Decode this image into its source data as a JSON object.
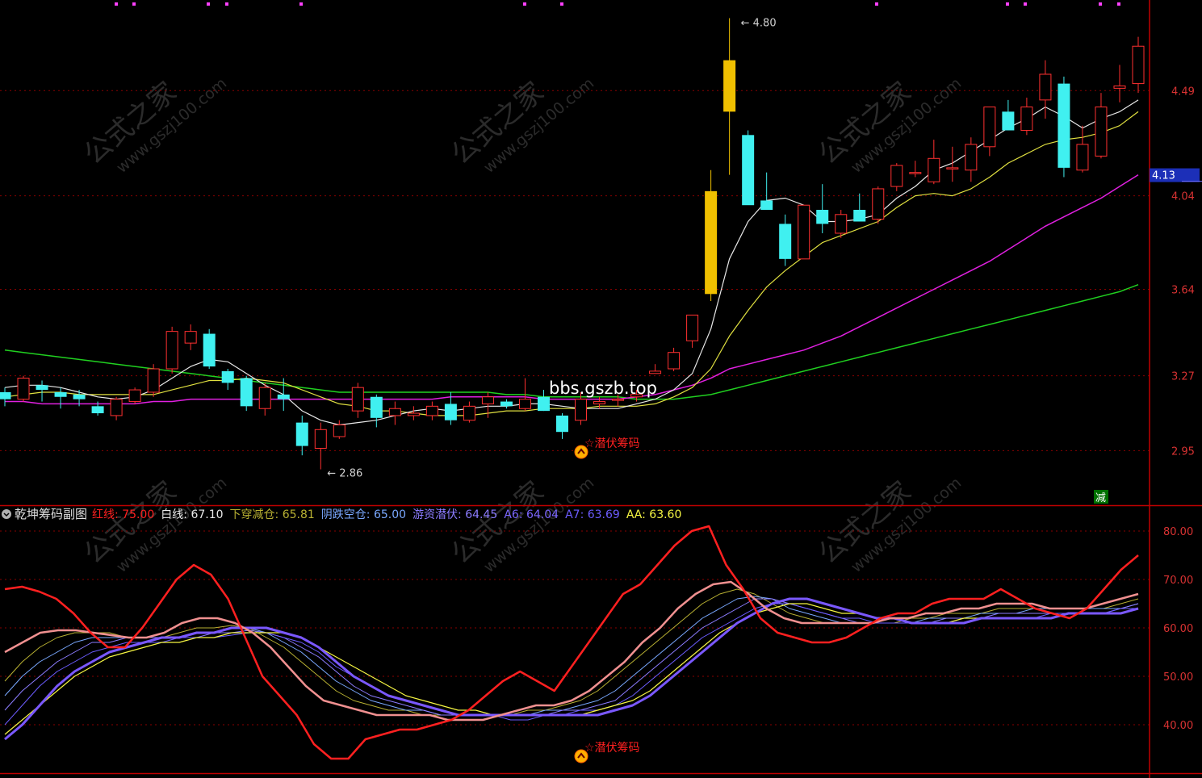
{
  "watermark": {
    "cn": "公式之家",
    "url": "www.gszj100.com"
  },
  "site_label": "bbs.gszb.top",
  "main_panel": {
    "price_axis": {
      "ticks": [
        4.49,
        4.04,
        3.64,
        3.27,
        2.95
      ],
      "min": 2.72,
      "max": 4.85
    },
    "current_price_tag": {
      "value": "4.13",
      "color": "#1c2fb8"
    },
    "high_marker": {
      "value": 4.8,
      "text": "4.80"
    },
    "low_marker": {
      "value": 2.86,
      "text": "2.86"
    },
    "signal_label": "潜伏筹码",
    "corner_badge": "减"
  },
  "sub_panel": {
    "title": "乾坤筹码副图",
    "legend": [
      {
        "key": "红线",
        "label": "红线: ",
        "value": "75.00",
        "color": "#ff2020"
      },
      {
        "key": "白线",
        "label": "白线: ",
        "value": "67.10",
        "color": "#e8e8e8"
      },
      {
        "key": "下穿减仓",
        "label": "下穿减仓: ",
        "value": "65.81",
        "color": "#b8b032"
      },
      {
        "key": "阴跌空仓",
        "label": "阴跌空仓: ",
        "value": "65.00",
        "color": "#7aa8ff"
      },
      {
        "key": "游资潜伏",
        "label": "游资潜伏: ",
        "value": "64.45",
        "color": "#8c7cff"
      },
      {
        "key": "A6",
        "label": "A6: ",
        "value": "64.04",
        "color": "#7b66ff"
      },
      {
        "key": "A7",
        "label": "A7: ",
        "value": "63.69",
        "color": "#6c5cff"
      },
      {
        "key": "AA",
        "label": "AA: ",
        "value": "63.60",
        "color": "#f5f542"
      }
    ],
    "value_axis": {
      "ticks": [
        "80.00",
        "70.00",
        "60.00",
        "50.00",
        "40.00"
      ],
      "min": 30,
      "max": 85
    },
    "signal_label": "潜伏筹码"
  },
  "chart_data": [
    {
      "type": "candlestick",
      "title": "",
      "ylim": [
        2.72,
        4.85
      ],
      "candles": [
        [
          3.2,
          3.22,
          3.14,
          3.17
        ],
        [
          3.17,
          3.27,
          3.16,
          3.26
        ],
        [
          3.23,
          3.25,
          3.16,
          3.21
        ],
        [
          3.2,
          3.22,
          3.13,
          3.18
        ],
        [
          3.19,
          3.21,
          3.14,
          3.17
        ],
        [
          3.14,
          3.16,
          3.1,
          3.11
        ],
        [
          3.1,
          3.18,
          3.08,
          3.17
        ],
        [
          3.16,
          3.22,
          3.15,
          3.21
        ],
        [
          3.2,
          3.32,
          3.18,
          3.3
        ],
        [
          3.3,
          3.48,
          3.28,
          3.46
        ],
        [
          3.41,
          3.49,
          3.38,
          3.46
        ],
        [
          3.45,
          3.47,
          3.3,
          3.31
        ],
        [
          3.29,
          3.3,
          3.21,
          3.24
        ],
        [
          3.26,
          3.27,
          3.12,
          3.14
        ],
        [
          3.13,
          3.24,
          3.1,
          3.22
        ],
        [
          3.19,
          3.26,
          3.12,
          3.17
        ],
        [
          3.07,
          3.1,
          2.93,
          2.97
        ],
        [
          2.96,
          3.07,
          2.87,
          3.04
        ],
        [
          3.01,
          3.08,
          3.0,
          3.06
        ],
        [
          3.12,
          3.24,
          3.09,
          3.22
        ],
        [
          3.18,
          3.19,
          3.05,
          3.09
        ],
        [
          3.1,
          3.16,
          3.06,
          3.13
        ],
        [
          3.1,
          3.14,
          3.08,
          3.11
        ],
        [
          3.1,
          3.16,
          3.08,
          3.14
        ],
        [
          3.15,
          3.2,
          3.06,
          3.08
        ],
        [
          3.08,
          3.16,
          3.07,
          3.14
        ],
        [
          3.15,
          3.2,
          3.09,
          3.18
        ],
        [
          3.16,
          3.17,
          3.13,
          3.14
        ],
        [
          3.13,
          3.26,
          3.12,
          3.17
        ],
        [
          3.18,
          3.21,
          3.12,
          3.12
        ],
        [
          3.1,
          3.11,
          3.0,
          3.03
        ],
        [
          3.08,
          3.2,
          3.06,
          3.17
        ],
        [
          3.15,
          3.18,
          3.13,
          3.16
        ],
        [
          3.17,
          3.19,
          3.14,
          3.17
        ],
        [
          3.18,
          3.21,
          3.16,
          3.19
        ],
        [
          3.28,
          3.32,
          3.28,
          3.29
        ],
        [
          3.3,
          3.39,
          3.29,
          3.37
        ],
        [
          3.42,
          3.52,
          3.39,
          3.53
        ],
        [
          3.62,
          4.15,
          3.59,
          4.06
        ],
        [
          4.4,
          4.8,
          4.13,
          4.62
        ],
        [
          4.3,
          4.32,
          4.12,
          4.0
        ],
        [
          4.02,
          4.14,
          3.98,
          3.98
        ],
        [
          3.92,
          3.96,
          3.74,
          3.77
        ],
        [
          3.77,
          4.0,
          3.79,
          4.0
        ],
        [
          3.98,
          4.09,
          3.88,
          3.92
        ],
        [
          3.88,
          3.98,
          3.86,
          3.96
        ],
        [
          3.98,
          4.05,
          3.94,
          3.93
        ],
        [
          3.94,
          4.08,
          3.92,
          4.07
        ],
        [
          4.08,
          4.18,
          4.06,
          4.17
        ],
        [
          4.14,
          4.19,
          4.12,
          4.14
        ],
        [
          4.1,
          4.28,
          4.09,
          4.2
        ],
        [
          4.16,
          4.25,
          4.1,
          4.16
        ],
        [
          4.15,
          4.29,
          4.1,
          4.26
        ],
        [
          4.25,
          4.4,
          4.21,
          4.42
        ],
        [
          4.4,
          4.45,
          4.32,
          4.32
        ],
        [
          4.32,
          4.46,
          4.3,
          4.42
        ],
        [
          4.45,
          4.62,
          4.37,
          4.56
        ],
        [
          4.52,
          4.55,
          4.12,
          4.16
        ],
        [
          4.15,
          4.34,
          4.14,
          4.26
        ],
        [
          4.21,
          4.48,
          4.2,
          4.42
        ],
        [
          4.5,
          4.6,
          4.44,
          4.51
        ],
        [
          4.52,
          4.72,
          4.48,
          4.68
        ]
      ],
      "ma_white": [
        3.22,
        3.23,
        3.23,
        3.22,
        3.2,
        3.18,
        3.17,
        3.18,
        3.21,
        3.26,
        3.31,
        3.34,
        3.33,
        3.28,
        3.23,
        3.19,
        3.12,
        3.08,
        3.06,
        3.07,
        3.08,
        3.1,
        3.12,
        3.13,
        3.12,
        3.13,
        3.14,
        3.14,
        3.15,
        3.15,
        3.14,
        3.13,
        3.13,
        3.13,
        3.15,
        3.17,
        3.21,
        3.28,
        3.47,
        3.77,
        3.93,
        4.02,
        4.03,
        4.0,
        3.93,
        3.93,
        3.94,
        3.96,
        4.03,
        4.08,
        4.15,
        4.18,
        4.23,
        4.28,
        4.33,
        4.37,
        4.42,
        4.38,
        4.33,
        4.37,
        4.4,
        4.45
      ],
      "ma_yellow": [
        3.18,
        3.19,
        3.2,
        3.2,
        3.19,
        3.19,
        3.19,
        3.19,
        3.19,
        3.21,
        3.23,
        3.25,
        3.25,
        3.26,
        3.25,
        3.24,
        3.21,
        3.18,
        3.15,
        3.14,
        3.12,
        3.12,
        3.11,
        3.1,
        3.1,
        3.1,
        3.11,
        3.12,
        3.12,
        3.13,
        3.13,
        3.13,
        3.14,
        3.14,
        3.14,
        3.15,
        3.18,
        3.22,
        3.3,
        3.44,
        3.55,
        3.65,
        3.72,
        3.78,
        3.84,
        3.87,
        3.9,
        3.93,
        3.99,
        4.04,
        4.05,
        4.04,
        4.07,
        4.12,
        4.18,
        4.22,
        4.26,
        4.28,
        4.29,
        4.31,
        4.34,
        4.4
      ],
      "ma_magenta": [
        3.16,
        3.16,
        3.15,
        3.15,
        3.15,
        3.15,
        3.15,
        3.15,
        3.16,
        3.16,
        3.17,
        3.17,
        3.17,
        3.17,
        3.17,
        3.17,
        3.17,
        3.17,
        3.17,
        3.17,
        3.17,
        3.17,
        3.17,
        3.17,
        3.18,
        3.18,
        3.18,
        3.18,
        3.18,
        3.17,
        3.17,
        3.17,
        3.17,
        3.17,
        3.18,
        3.19,
        3.21,
        3.23,
        3.26,
        3.3,
        3.32,
        3.34,
        3.36,
        3.38,
        3.41,
        3.44,
        3.48,
        3.52,
        3.56,
        3.6,
        3.64,
        3.68,
        3.72,
        3.76,
        3.81,
        3.86,
        3.91,
        3.95,
        3.99,
        4.03,
        4.08,
        4.13
      ],
      "ma_green": [
        3.38,
        3.37,
        3.36,
        3.35,
        3.34,
        3.33,
        3.32,
        3.31,
        3.3,
        3.29,
        3.28,
        3.27,
        3.26,
        3.25,
        3.24,
        3.23,
        3.22,
        3.21,
        3.2,
        3.2,
        3.2,
        3.2,
        3.2,
        3.2,
        3.2,
        3.2,
        3.2,
        3.19,
        3.19,
        3.18,
        3.18,
        3.18,
        3.18,
        3.18,
        3.17,
        3.17,
        3.17,
        3.18,
        3.19,
        3.21,
        3.23,
        3.25,
        3.27,
        3.29,
        3.31,
        3.33,
        3.35,
        3.37,
        3.39,
        3.41,
        3.43,
        3.45,
        3.47,
        3.49,
        3.51,
        3.53,
        3.55,
        3.57,
        3.59,
        3.61,
        3.63,
        3.66
      ],
      "marker_levels": {
        "high": 4.8,
        "low": 2.86
      }
    },
    {
      "type": "line",
      "title": "乾坤筹码副图",
      "ylim": [
        30,
        85
      ],
      "red_line": [
        68,
        68.5,
        67.5,
        66,
        63,
        59,
        56,
        56,
        60,
        65,
        70,
        73,
        71,
        66,
        58,
        50,
        46,
        42,
        36,
        33,
        33,
        37,
        38,
        39,
        39,
        40,
        41,
        43,
        46,
        49,
        51,
        49,
        47,
        52,
        57,
        62,
        67,
        69,
        73,
        77,
        80,
        81,
        73,
        68,
        62,
        59,
        58,
        57,
        57,
        58,
        60,
        62,
        63,
        63,
        65,
        66,
        66,
        66,
        68,
        66,
        64,
        63,
        62,
        64,
        68,
        72,
        75
      ],
      "white_line": [
        55,
        57,
        59,
        59.5,
        59.5,
        59,
        58.5,
        58,
        58,
        59,
        61,
        62,
        62,
        61,
        59,
        56,
        52,
        48,
        45,
        44,
        43,
        42,
        42,
        42,
        42,
        41,
        41,
        41,
        42,
        43,
        44,
        44,
        45,
        47,
        50,
        53,
        57,
        60,
        64,
        67,
        69,
        69.5,
        67,
        64,
        62,
        61,
        61,
        61,
        61,
        61,
        62,
        62,
        63,
        63,
        64,
        64,
        65,
        65,
        65,
        64,
        64,
        64,
        65,
        66,
        67
      ],
      "mid_lines": [
        [
          49,
          53,
          56,
          58,
          59,
          59,
          59,
          58,
          58,
          58,
          59,
          60,
          60,
          60.5,
          60,
          58,
          56,
          53,
          50,
          47,
          45,
          44,
          43,
          43,
          42,
          42,
          42,
          42,
          42,
          42,
          43,
          43,
          44,
          45,
          47,
          50,
          53,
          56,
          59,
          62,
          65,
          67,
          68,
          67,
          65,
          63,
          62,
          61,
          61,
          61,
          61,
          61,
          62,
          62,
          63,
          63,
          63,
          64,
          64,
          64,
          64,
          64,
          64,
          64,
          65,
          66
        ],
        [
          46,
          50,
          53,
          55,
          57,
          58,
          58,
          58,
          58,
          58,
          58,
          59,
          59,
          60,
          60,
          59,
          57,
          55,
          52,
          49,
          47,
          45,
          44,
          43,
          43,
          42,
          42,
          42,
          42,
          42,
          42,
          43,
          43,
          44,
          45,
          47,
          50,
          53,
          56,
          59,
          62,
          64,
          66,
          66.5,
          66,
          64,
          63,
          62,
          61,
          61,
          61,
          61,
          61,
          62,
          62,
          62,
          63,
          63,
          63,
          64,
          64,
          64,
          64,
          64,
          64,
          65
        ],
        [
          43,
          47,
          50,
          53,
          55,
          57,
          57,
          58,
          58,
          58,
          58,
          58,
          59,
          59,
          59.5,
          59,
          58,
          56,
          54,
          51,
          48,
          46,
          45,
          44,
          43,
          42,
          42,
          42,
          42,
          42,
          42,
          42,
          43,
          43,
          44,
          45,
          48,
          51,
          54,
          57,
          60,
          62,
          64,
          66,
          66,
          65,
          64,
          63,
          62,
          61,
          61,
          61,
          61,
          61,
          62,
          62,
          62,
          63,
          63,
          63,
          63,
          63,
          63,
          63,
          64,
          65
        ],
        [
          40,
          44,
          48,
          51,
          53,
          55,
          56,
          57,
          57,
          57,
          58,
          58,
          58,
          58.5,
          59,
          59,
          58,
          57,
          55,
          52,
          50,
          48,
          46,
          45,
          44,
          43,
          42,
          42,
          42,
          41,
          41,
          42,
          42,
          43,
          43,
          44,
          46,
          49,
          52,
          55,
          58,
          60,
          62,
          64,
          65,
          65,
          64,
          63,
          62,
          62,
          61,
          61,
          61,
          61,
          61,
          62,
          62,
          62,
          62,
          62,
          63,
          63,
          63,
          63,
          64,
          64
        ]
      ],
      "yellow_line": [
        38,
        41,
        44,
        47,
        50,
        52,
        54,
        55,
        56,
        57,
        57,
        58,
        58,
        59,
        59,
        59,
        59,
        58,
        56,
        54,
        52,
        50,
        48,
        46,
        45,
        44,
        43,
        43,
        42,
        42,
        42,
        42,
        42,
        42,
        43,
        44,
        45,
        47,
        50,
        53,
        56,
        59,
        61,
        63,
        64,
        65,
        65,
        64,
        63,
        63,
        62,
        62,
        61,
        61,
        61,
        62,
        62,
        62,
        62,
        62,
        62,
        63,
        63,
        63,
        63,
        64
      ],
      "purple_bold": [
        37,
        40,
        44,
        48,
        51,
        53,
        55,
        56,
        57,
        58,
        58,
        59,
        59,
        60,
        60,
        60,
        59,
        58,
        56,
        53,
        50,
        48,
        46,
        45,
        44,
        43,
        42,
        42,
        42,
        42,
        42,
        42,
        42,
        42,
        42,
        43,
        44,
        46,
        49,
        52,
        55,
        58,
        61,
        63,
        65,
        66,
        66,
        65,
        64,
        63,
        62,
        62,
        61,
        61,
        61,
        61,
        62,
        62,
        62,
        62,
        62,
        63,
        63,
        63,
        63,
        64
      ]
    }
  ]
}
